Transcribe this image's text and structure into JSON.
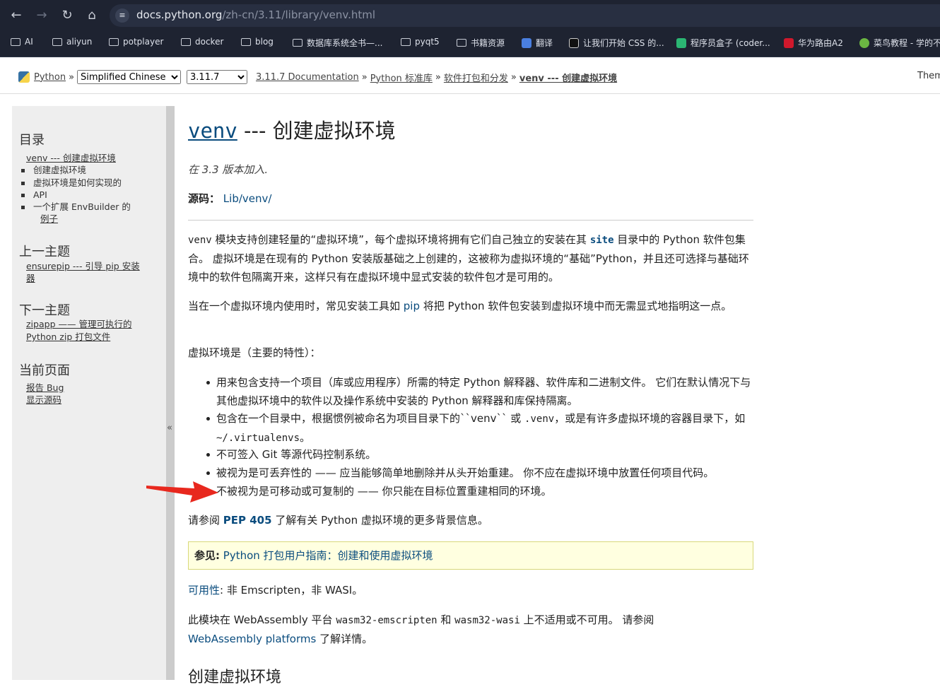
{
  "browser": {
    "url_host": "docs.python.org",
    "url_path": "/zh-cn/3.11/library/venv.html",
    "bookmarks": [
      "AI",
      "aliyun",
      "potplayer",
      "docker",
      "blog",
      "数据库系统全书—...",
      "pyqt5",
      "书籍资源",
      "翻译",
      "让我们开始 CSS 的...",
      "程序员盒子 (coder...",
      "华为路由A2",
      "菜鸟教程 - 学的不"
    ],
    "colors": {
      "chrome": "#1e2331",
      "omnibox": "#282f41"
    }
  },
  "header": {
    "python_link": "Python",
    "sep": "»",
    "language_select": "Simplified Chinese",
    "version_select": "3.11.7",
    "crumbs": [
      "3.11.7 Documentation",
      "Python 标准库",
      "软件打包和分发",
      "venv --- 创建虚拟环境"
    ],
    "theme_label": "Them"
  },
  "sidebar": {
    "toc_heading": "目录",
    "toc_main": "venv --- 创建虚拟环境",
    "toc_items": [
      "创建虚拟环境",
      "虚拟环境是如何实现的",
      "API",
      "一个扩展 EnvBuilder 的",
      "例子"
    ],
    "prev_heading": "上一主题",
    "prev_link": "ensurepip --- 引导 pip 安装",
    "prev_link_2": "器",
    "next_heading": "下一主题",
    "next_link": "zipapp —— 管理可执行的",
    "next_link_2": "Python zip 打包文件",
    "page_heading": "当前页面",
    "report_bug": "报告 Bug",
    "show_source": "显示源码",
    "collapse": "«"
  },
  "main": {
    "title_code": "venv",
    "title_rest": " --- 创建虚拟环境",
    "added": "在 3.3 版本加入.",
    "source_label": "源码：",
    "source_link": "Lib/venv/",
    "p1_a": "venv",
    "p1_b": " 模块支持创建轻量的“虚拟环境”，每个虚拟环境将拥有它们自己独立的安装在其 ",
    "p1_c": "site",
    "p1_d": " 目录中的 Python 软件包集合。 虚拟环境是在现有的 Python 安装版基础之上创建的，这被称为虚拟环境的“基础”Python，并且还可选择与基础环境中的软件包隔离开来，这样只有在虚拟环境中显式安装的软件包才是可用的。",
    "p2_a": "当在一个虚拟环境内使用时，常见安装工具如 ",
    "p2_b": "pip",
    "p2_c": " 将把 Python 软件包安装到虚拟环境中而无需显式地指明这一点。",
    "p3": "虚拟环境是（主要的特性）：",
    "li1": "用来包含支持一个项目（库或应用程序）所需的特定 Python 解释器、软件库和二进制文件。 它们在默认情况下与其他虚拟环境中的软件以及操作系统中安装的 Python 解释器和库保持隔离。",
    "li2_a": "包含在一个目录中，根据惯例被命名为项目目录下的``venv`` 或 ",
    "li2_b": ".venv",
    "li2_c": "，或是有许多虚拟环境的容器目录下，如 ",
    "li2_d": "~/.virtualenvs",
    "li2_e": "。",
    "li3": "不可签入 Git 等源代码控制系统。",
    "li4": "被视为是可丢弃性的 —— 应当能够简单地删除并从头开始重建。 你不应在虚拟环境中放置任何项目代码。",
    "li5": "不被视为是可移动或可复制的 —— 你只能在目标位置重建相同的环境。",
    "p4_a": "请参阅 ",
    "p4_b": "PEP 405",
    "p4_c": " 了解有关 Python 虚拟环境的更多背景信息。",
    "seealso_label": "参见:",
    "seealso_link": "Python 打包用户指南：创建和使用虚拟环境",
    "avail_link": "可用性",
    "avail_rest": ": 非 Emscripten，非 WASI。",
    "p5_a": "此模块在 WebAssembly 平台 ",
    "p5_b": "wasm32-emscripten",
    "p5_c": " 和 ",
    "p5_d": "wasm32-wasi",
    "p5_e": " 上不适用或不可用。 请参阅",
    "p5_f": "WebAssembly platforms",
    "p5_g": " 了解详情。",
    "h2": "创建虚拟环境"
  },
  "annotation": {
    "color": "#e8281e"
  }
}
